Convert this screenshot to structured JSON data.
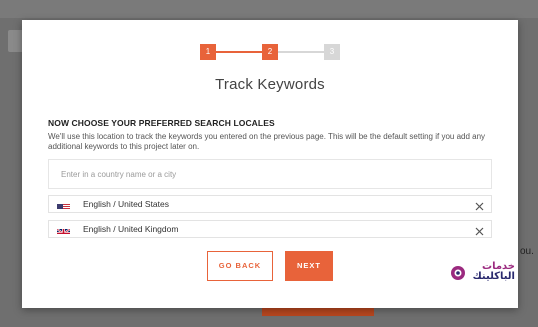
{
  "background": {
    "partial_text": "ou."
  },
  "modal": {
    "steps": [
      {
        "number": "1",
        "state": "complete"
      },
      {
        "number": "2",
        "state": "current"
      },
      {
        "number": "3",
        "state": "upcoming"
      }
    ],
    "title": "Track Keywords",
    "section_heading": "NOW CHOOSE YOUR PREFERRED SEARCH LOCALES",
    "description": "We'll use this location to track the keywords you entered on the previous page. This will be the default setting if you add any additional keywords to this project later on.",
    "search": {
      "value": "",
      "placeholder": "Enter in a country name or a city"
    },
    "locales": [
      {
        "flag_icon": "us-flag-icon",
        "label": "English / United States"
      },
      {
        "flag_icon": "uk-flag-icon",
        "label": "English / United Kingdom"
      }
    ],
    "buttons": {
      "back_label": "GO BACK",
      "next_label": "NEXT"
    }
  },
  "watermark": {
    "line1": "خدمات",
    "line2": "الباكلينك"
  },
  "colors": {
    "accent": "#e8633a",
    "inactive_step": "#d7d7d7",
    "overlay": "#6f6f6f"
  }
}
